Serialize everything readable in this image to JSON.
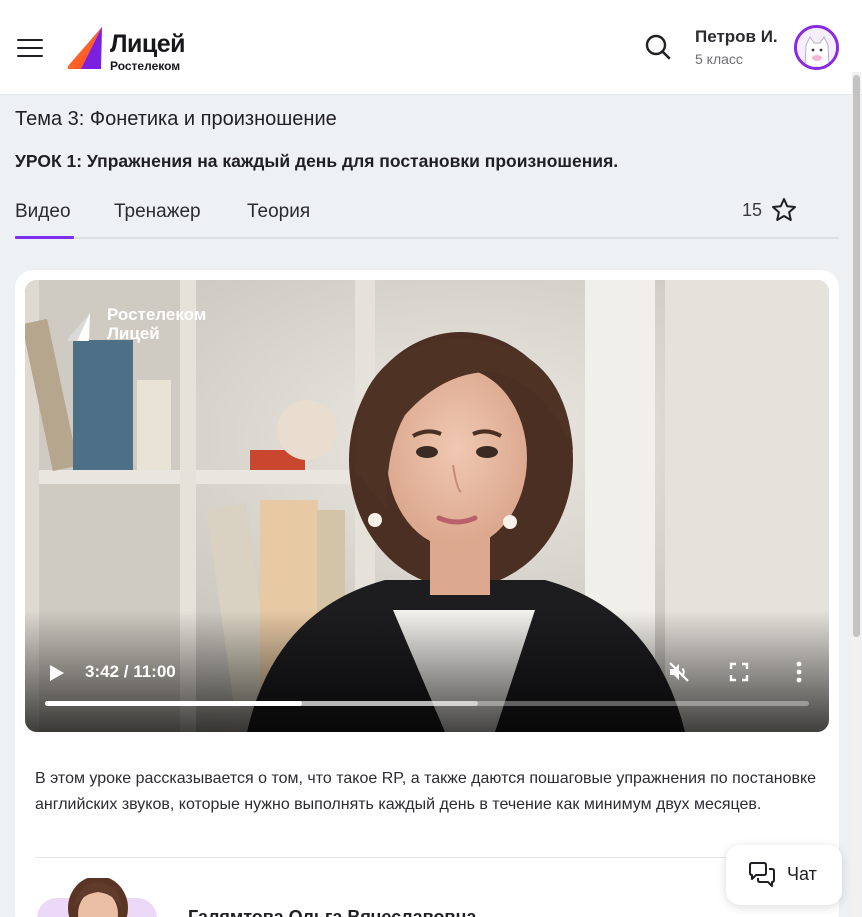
{
  "header": {
    "logo_title": "Лицей",
    "logo_subtitle": "Ростелеком",
    "user_name": "Петров И.",
    "user_grade": "5 класс",
    "icons": [
      "menu-icon",
      "search-icon",
      "avatar"
    ]
  },
  "lesson": {
    "topic": "Тема 3: Фонетика и произношение",
    "title": "УРОК 1: Упражнения на каждый день для постановки произношения."
  },
  "tabs": {
    "items": [
      {
        "label": "Видео",
        "active": true
      },
      {
        "label": "Тренажер",
        "active": false
      },
      {
        "label": "Теория",
        "active": false
      }
    ],
    "rating_count": "15"
  },
  "video": {
    "watermark_line1": "Ростелеком",
    "watermark_line2": "Лицей",
    "time": "3:42 / 11:00",
    "progress_fraction": 0.336,
    "buffered_fraction": 0.567,
    "muted": true,
    "controls": [
      "play-icon",
      "mute-icon",
      "fullscreen-icon",
      "more-icon"
    ]
  },
  "description": "В этом уроке рассказывается о том, что такое RP, а также даются пошаговые упражнения по постановке английских звуков, которые нужно выполнять каждый день в течение как минимум двух месяцев.",
  "teacher": {
    "name": "Галямтова Ольга Вячеславовна"
  },
  "chat": {
    "label": "Чат"
  },
  "colors": {
    "accent": "#7b2ff0",
    "avatar_border": "#8a2be2",
    "page_background": "#eef1f4",
    "logo_orange": "#ff5a1f",
    "logo_purple": "#7b1fe0"
  }
}
